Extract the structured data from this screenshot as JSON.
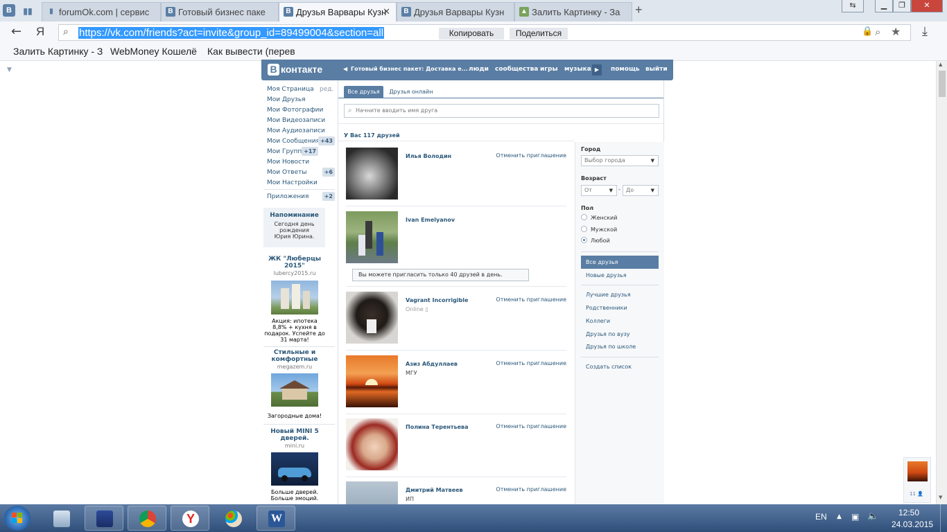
{
  "browser": {
    "tabs": [
      {
        "label": "forumOk.com | сервис",
        "icon": "book-icon"
      },
      {
        "label": "Готовый бизнес паке",
        "icon": "vk-icon"
      },
      {
        "label": "Друзья Варвары Кузн",
        "icon": "vk-icon",
        "close": "✕"
      },
      {
        "label": "Друзья Варвары Кузн",
        "icon": "vk-icon"
      },
      {
        "label": "Залить Картинку - За",
        "icon": "image-icon"
      }
    ],
    "new_tab": "+",
    "yandex_letter": "Я",
    "url": "https://vk.com/friends?act=invite&group_id=89499004&section=all",
    "copy_label": "Копировать",
    "share_label": "Поделиться",
    "bookmarks": [
      "Залить Картинку - З",
      "WebMoney Кошелё",
      "Как вывести (перев"
    ]
  },
  "vk": {
    "logo": "контакте",
    "logo_letter": "В",
    "header_news": "Готовый бизнес пакет: Доставка е...",
    "nav": [
      "люди",
      "сообщества",
      "игры",
      "музыка",
      "помощь",
      "выйти"
    ],
    "left_menu": [
      {
        "label": "Моя Страница",
        "extra": "ред."
      },
      {
        "label": "Мои Друзья"
      },
      {
        "label": "Мои Фотографии"
      },
      {
        "label": "Мои Видеозаписи"
      },
      {
        "label": "Мои Аудиозаписи"
      },
      {
        "label": "Мои Сообщения",
        "badge": "+43"
      },
      {
        "label": "Мои Группы",
        "badge": "+17"
      },
      {
        "label": "Мои Новости"
      },
      {
        "label": "Мои Ответы",
        "badge": "+6"
      },
      {
        "label": "Мои Настройки"
      }
    ],
    "apps": {
      "label": "Приложения",
      "badge": "+2"
    },
    "reminder": {
      "title": "Напоминание",
      "text": "Сегодня день рождения Юрия Юрина."
    },
    "ads": [
      {
        "title": "ЖК \"Люберцы 2015\"",
        "site": "lubercy2015.ru",
        "text": "Акция: ипотека 8,8% + кухня в подарок. Успейте до 31 марта!"
      },
      {
        "title": "Стильные и комфортные",
        "site": "megazem.ru",
        "text": "Загородные дома!"
      },
      {
        "title": "Новый MINI 5 дверей.",
        "site": "mini.ru",
        "text": "Больше дверей. Больше эмоций."
      }
    ],
    "tabs": [
      "Все друзья",
      "Друзья онлайн"
    ],
    "search_placeholder": "Начните вводить имя друга",
    "count": "У Вас 117 друзей",
    "cancel_label": "Отменить приглашение",
    "limit_note": "Вы можете пригласить только 40 друзей в день.",
    "friends": [
      {
        "name": "Илья Володин",
        "sub": "",
        "cancel": true
      },
      {
        "name": "Ivan Emelyanov",
        "sub": "",
        "cancel": false
      },
      {
        "name": "Vagrant Incorrigible",
        "sub": "Online",
        "cancel": true
      },
      {
        "name": "Азиз Абдуллаев",
        "sub": "МГУ",
        "cancel": true
      },
      {
        "name": "Полина Терентьева",
        "sub": "",
        "cancel": true
      },
      {
        "name": "Дмитрий Матвеев",
        "sub": "ИП",
        "cancel": true
      }
    ],
    "filters": {
      "city_label": "Город",
      "city_value": "Выбор города",
      "age_label": "Возраст",
      "age_from": "От",
      "age_dash": "-",
      "age_to": "До",
      "sex_label": "Пол",
      "sex_options": [
        "Женский",
        "Мужской",
        "Любой"
      ],
      "sex_selected": 2,
      "sections": [
        "Все друзья",
        "Новые друзья"
      ],
      "lists": [
        "Лучшие друзья",
        "Родственники",
        "Коллеги",
        "Друзья по вузу",
        "Друзья по школе"
      ],
      "create_list": "Создать список"
    },
    "online_count": "11"
  },
  "taskbar": {
    "lang": "EN",
    "time": "12:50",
    "date": "24.03.2015",
    "apps": [
      "calculator-icon",
      "disk-icon",
      "chrome-icon",
      "yandex-icon",
      "paint-icon",
      "word-icon"
    ]
  }
}
